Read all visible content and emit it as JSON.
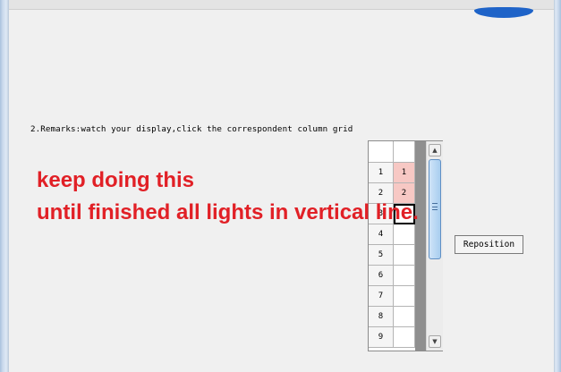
{
  "remarks": {
    "text": "2.Remarks:watch your display,click the correspondent column grid"
  },
  "overlay": {
    "line1": "keep doing this",
    "line2": "until finished all lights in vertical line."
  },
  "grid": {
    "rows": [
      {
        "index": "1",
        "value": "1",
        "lit": true
      },
      {
        "index": "2",
        "value": "2",
        "lit": true
      },
      {
        "index": "3",
        "value": "",
        "lit": false,
        "current": true
      },
      {
        "index": "4",
        "value": "",
        "lit": false
      },
      {
        "index": "5",
        "value": "",
        "lit": false
      },
      {
        "index": "6",
        "value": "",
        "lit": false
      },
      {
        "index": "7",
        "value": "",
        "lit": false
      },
      {
        "index": "8",
        "value": "",
        "lit": false
      },
      {
        "index": "9",
        "value": "",
        "lit": false
      }
    ]
  },
  "buttons": {
    "reposition": "Reposition"
  },
  "icons": {
    "scroll_up": "scroll-up-icon",
    "scroll_down": "scroll-down-icon",
    "scroll_up_glyph": "▲",
    "scroll_down_glyph": "▼"
  },
  "colors": {
    "overlay_text": "#e12026",
    "lit_cell": "#f7c8c4",
    "accent_blue": "#1e63c8"
  }
}
